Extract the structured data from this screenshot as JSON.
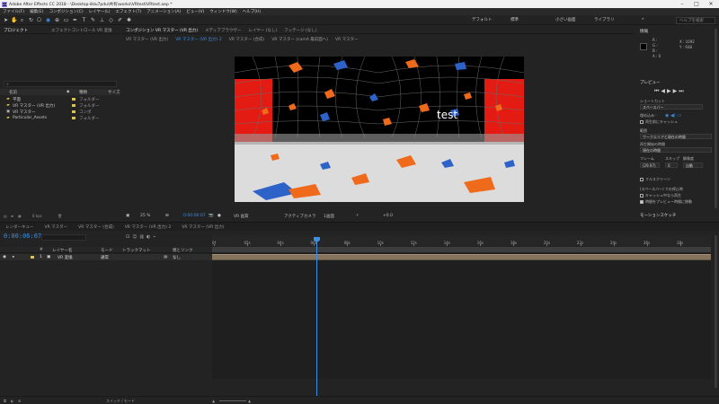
{
  "title": "Adobe After Effects CC 2018 - \\Desktop-8du7pdu\\共有\\works\\VRtest\\VRtest.aep *",
  "menu": [
    "ファイル(F)",
    "編集(E)",
    "コンポジション(C)",
    "レイヤー(L)",
    "エフェクト(T)",
    "アニメーション(A)",
    "ビュー(V)",
    "ウィンドウ(W)",
    "ヘルプ(H)"
  ],
  "workspaces": [
    "デフォルト",
    "標準",
    "小さい画面",
    "ライブラリ"
  ],
  "search_placeholder": "ヘルプを検索",
  "project": {
    "tab": "プロジェクト",
    "effect_tab": "エフェクトコントロール VR 変換",
    "col_name": "名前",
    "col_type": "種類",
    "col_size": "サイズ",
    "items": [
      {
        "name": "平面",
        "type": "フォルダー",
        "icon": "folder-icon"
      },
      {
        "name": "VR マスター (VR 出力)",
        "type": "フォルダー",
        "icon": "folder-icon"
      },
      {
        "name": "VR マスター",
        "type": "コンポ",
        "icon": "composition-icon"
      },
      {
        "name": "Particular_Assets",
        "type": "フォルダー",
        "icon": "folder-icon"
      }
    ],
    "bpc": "8 bpc"
  },
  "composition": {
    "tabs": [
      "コンポジション VR マスター (VR 出力)",
      "メディアブラウザー",
      "レイヤー (なし)",
      "フッテージ (なし)"
    ],
    "subtabs": [
      "VR マスター (VR 出力)",
      "VR マスター (VR 出力) 2",
      "VR マスター (合成)",
      "VR マスター (camA 最前面へ)",
      "VR マスター"
    ],
    "breadcrumbs": [
      "VR マスター (VR 出力)",
      "VR マスター (VR 出力) 2",
      "VR マスター (合成)",
      "VR マスター (camA 最前面へ)",
      "VR マスター"
    ],
    "overlay_text": "test",
    "zoom": "25 %",
    "timecode": "0:00:06:07",
    "view_mode": "VR 画質",
    "camera": "アクティブカメラ",
    "views": "1画面",
    "exposure": "+0.0"
  },
  "info": {
    "title": "情報",
    "r": "R :",
    "g": "G :",
    "b": "B :",
    "a": "A : 0",
    "x": "X : 1092",
    "y": "Y : 938"
  },
  "preview": {
    "title": "プレビュー",
    "shortcut_label": "ショートカット",
    "shortcut_value": "スペースバー",
    "include_label": "埋め込み :",
    "cache_label": "再生前にキャッシュ",
    "range_label": "範囲",
    "range_value": "ワークエリアと現在の時間",
    "start_label": "再生開始の時間",
    "start_value": "現在の時間",
    "frame_label": "フレーム",
    "skip_label": "スキップ",
    "res_label": "解像度",
    "frame_value": "(29.97)",
    "skip_value": "0",
    "res_value": "自動",
    "fullscreen_label": "フルスクリーン",
    "stop_label": "(スペースバー) での停止時",
    "cache_opt": "キャッシュ中なら再生",
    "move_opt": "時間をプレビュー時間に移動",
    "motion_title": "モーションスケッチ"
  },
  "timeline": {
    "tabs": [
      "レンダーキュー",
      "VR マスター",
      "VR マスター (合成)",
      "VR マスター (VR 出力) 2",
      "VR マスター (VR 出力)"
    ],
    "timecode": "0:00:06:07",
    "col_num": "#",
    "col_name": "レイヤー名",
    "col_mode": "モード",
    "col_trkmat": "トラックマット",
    "col_parent": "親とリンク",
    "layer": {
      "num": "1",
      "name": "VR 変換",
      "mode": "通常",
      "parent": "なし"
    },
    "ticks": [
      "0f",
      "02s",
      "04s",
      "06s",
      "08s",
      "10s",
      "12s",
      "14s",
      "16s",
      "18s",
      "20s",
      "22s",
      "24s",
      "26s",
      "28s"
    ],
    "playhead_time": "06s",
    "footer_label": "スイッチ / モード"
  },
  "colors": {
    "accent": "#3a8fe6",
    "layerbar": "#86735e",
    "label_yellow": "#d9c54d"
  }
}
